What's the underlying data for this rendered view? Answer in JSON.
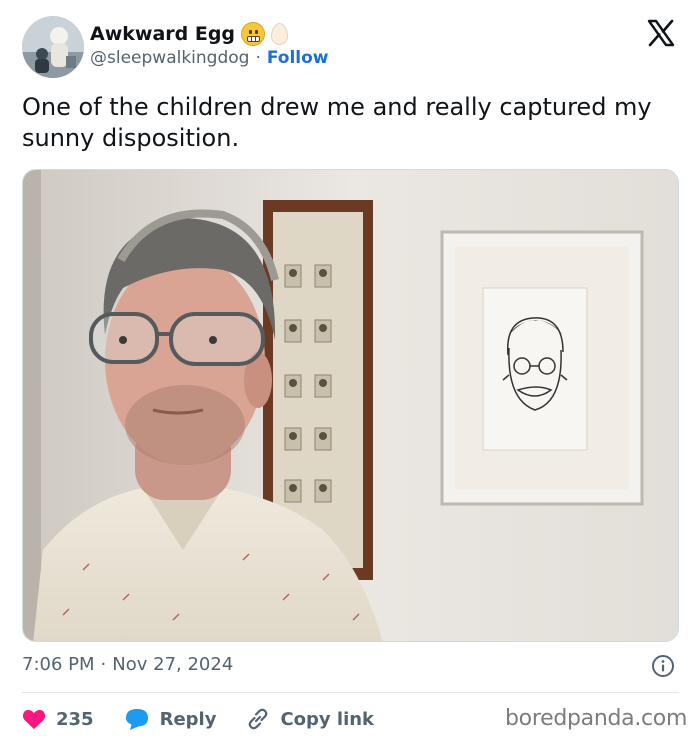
{
  "author": {
    "name": "Awkward Egg",
    "handle": "@sleepwalkingdog",
    "separator": "·",
    "follow_label": "Follow"
  },
  "tweet": {
    "text": "One of the children drew me and really captured my sunny disposition."
  },
  "meta": {
    "time": "7:06 PM",
    "separator": "·",
    "date": "Nov 27, 2024"
  },
  "actions": {
    "likes": "235",
    "reply_label": "Reply",
    "copy_label": "Copy link"
  },
  "watermark": "boredpanda.com",
  "colors": {
    "follow_blue": "#1d6fd8",
    "like_pink": "#f91880",
    "reply_blue": "#1d9bf0",
    "muted_gray": "#536471"
  },
  "icons": [
    "x-logo-icon",
    "grimace-emoji-icon",
    "egg-emoji-icon",
    "info-icon",
    "heart-icon",
    "reply-bubble-icon",
    "link-icon"
  ]
}
